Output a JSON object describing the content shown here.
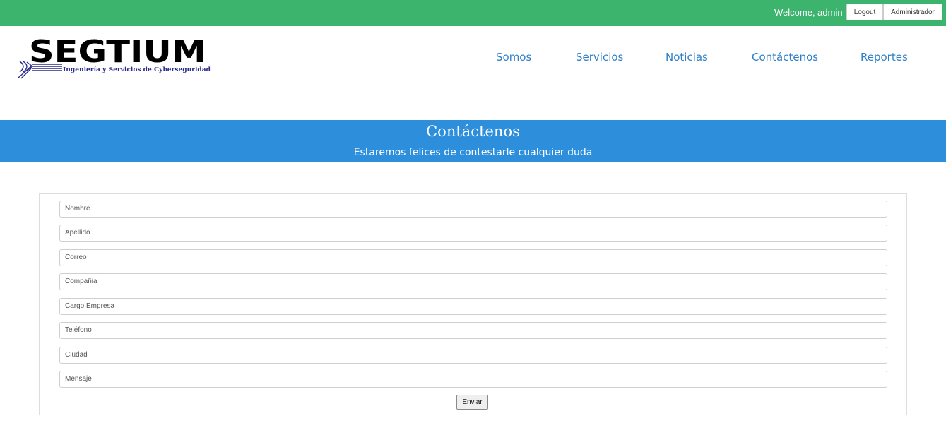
{
  "topbar": {
    "welcome_text": "Welcome, admin",
    "logout_label": "Logout",
    "admin_label": "Administrador",
    "bg_color": "#3db46d"
  },
  "logo": {
    "brand": "SEGTIUM",
    "tagline": "Ingeniería y Servicios de Cyberseguridad"
  },
  "nav": {
    "items": [
      {
        "label": "Somos"
      },
      {
        "label": "Servicios"
      },
      {
        "label": "Noticias"
      },
      {
        "label": "Contáctenos"
      },
      {
        "label": "Reportes"
      }
    ],
    "link_color": "#2e7fc8"
  },
  "banner": {
    "title": "Contáctenos",
    "subtitle": "Estaremos felices de contestarle cualquier duda",
    "bg_color": "#2d8fdb"
  },
  "form": {
    "fields": [
      {
        "placeholder": "Nombre"
      },
      {
        "placeholder": "Apellido"
      },
      {
        "placeholder": "Correo"
      },
      {
        "placeholder": "Compañia"
      },
      {
        "placeholder": "Cargo Empresa"
      },
      {
        "placeholder": "Teléfono"
      },
      {
        "placeholder": "Ciudad"
      },
      {
        "placeholder": "Mensaje"
      }
    ],
    "submit_label": "Enviar"
  }
}
